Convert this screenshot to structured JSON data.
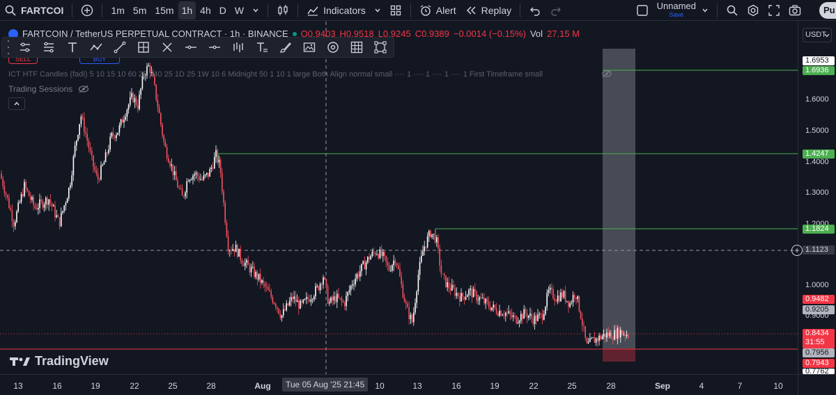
{
  "topbar": {
    "symbol": "FARTCOI",
    "timeframes": [
      "1m",
      "5m",
      "15m",
      "1h",
      "4h",
      "D",
      "W"
    ],
    "active_timeframe": "1h",
    "indicators_label": "Indicators",
    "alert_label": "Alert",
    "replay_label": "Replay",
    "layout_name": "Unnamed",
    "save_label": "Save",
    "publish_label": "Pu"
  },
  "legend": {
    "title": "FARTCOIN / TetherUS PERPETUAL CONTRACT · 1h · BINANCE",
    "open": "O0.9403",
    "high": "H0.9518",
    "low": "L0.9245",
    "close": "C0.9389",
    "change": "−0.0014 (−0.15%)",
    "volume_label": "Vol",
    "volume": "27.15 M"
  },
  "indicators": {
    "ict_line": "ICT HTF Candles (fadi) 5 10 15 10 60 25 240 25 1D 25 1W 10 6 Midnight 50 1 10 1 large Both Align normal small ···· 1 ···· 1 ···· 1 ···· 1 First Timeframe small",
    "sessions_label": "Trading Sessions",
    "sell_label": "SELL",
    "buy_label": "BUY"
  },
  "axis": {
    "currency": "USDT",
    "price_ticks": [
      "1.6000",
      "1.5000",
      "1.4000",
      "1.3000",
      "1.2000",
      "1.0000",
      "0.9000"
    ],
    "time_ticks": [
      "13",
      "16",
      "19",
      "22",
      "25",
      "28",
      "Aug",
      "10",
      "13",
      "16",
      "19",
      "22",
      "25",
      "28",
      "Sep",
      "4",
      "7",
      "10"
    ],
    "crosshair_time": "Tue 05 Aug '25   21:45"
  },
  "price_labels": {
    "level_top": "1.6953",
    "level_1": "1.6936",
    "level_2": "1.4247",
    "level_3": "1.1824",
    "crosshair": "1.1123",
    "red_1": "0.9482",
    "gray_1": "0.9205",
    "last_price": "0.8434",
    "countdown": "31:55",
    "gray_2": "0.7956",
    "red_2": "0.7943",
    "bottom": "0.7762"
  },
  "branding": {
    "logo_text": "TradingView"
  },
  "colors": {
    "background": "#131722",
    "down": "#f7525f",
    "up": "#ffffff",
    "level_green": "#4caf50",
    "level_red": "#f23645",
    "highlight_zone": "#d1d4dc"
  },
  "chart_data": {
    "type": "candlestick",
    "title": "FARTCOIN / TetherUS PERPETUAL CONTRACT · 1h · BINANCE",
    "price_axis_range": [
      0.75,
      1.8
    ],
    "horizontal_levels": [
      1.6936,
      1.4247,
      1.1824,
      0.7943
    ],
    "path_points": [
      [
        0,
        1.36
      ],
      [
        8,
        1.3
      ],
      [
        20,
        1.2
      ],
      [
        35,
        1.32
      ],
      [
        50,
        1.25
      ],
      [
        70,
        1.28
      ],
      [
        85,
        1.2
      ],
      [
        100,
        1.32
      ],
      [
        108,
        1.45
      ],
      [
        116,
        1.55
      ],
      [
        124,
        1.48
      ],
      [
        132,
        1.4
      ],
      [
        140,
        1.34
      ],
      [
        150,
        1.4
      ],
      [
        160,
        1.48
      ],
      [
        170,
        1.5
      ],
      [
        180,
        1.56
      ],
      [
        190,
        1.61
      ],
      [
        198,
        1.58
      ],
      [
        206,
        1.68
      ],
      [
        214,
        1.71
      ],
      [
        220,
        1.66
      ],
      [
        228,
        1.56
      ],
      [
        236,
        1.45
      ],
      [
        244,
        1.4
      ],
      [
        252,
        1.34
      ],
      [
        262,
        1.28
      ],
      [
        270,
        1.35
      ],
      [
        280,
        1.36
      ],
      [
        290,
        1.34
      ],
      [
        300,
        1.36
      ],
      [
        310,
        1.42
      ],
      [
        316,
        1.38
      ],
      [
        322,
        1.24
      ],
      [
        328,
        1.12
      ],
      [
        338,
        1.12
      ],
      [
        348,
        1.08
      ],
      [
        360,
        1.05
      ],
      [
        372,
        1.02
      ],
      [
        384,
        0.98
      ],
      [
        396,
        0.94
      ],
      [
        404,
        0.9
      ],
      [
        412,
        0.93
      ],
      [
        420,
        0.96
      ],
      [
        432,
        0.93
      ],
      [
        444,
        0.96
      ],
      [
        456,
        0.99
      ],
      [
        464,
        1.03
      ],
      [
        472,
        0.94
      ],
      [
        482,
        0.96
      ],
      [
        494,
        0.94
      ],
      [
        506,
        1.01
      ],
      [
        518,
        1.05
      ],
      [
        530,
        1.09
      ],
      [
        540,
        1.11
      ],
      [
        550,
        1.09
      ],
      [
        558,
        1.05
      ],
      [
        568,
        1.09
      ],
      [
        576,
        1.0
      ],
      [
        584,
        0.92
      ],
      [
        592,
        0.88
      ],
      [
        600,
        1.03
      ],
      [
        608,
        1.12
      ],
      [
        618,
        1.17
      ],
      [
        626,
        1.15
      ],
      [
        634,
        1.03
      ],
      [
        642,
        1.0
      ],
      [
        652,
        0.98
      ],
      [
        662,
        0.96
      ],
      [
        674,
        0.98
      ],
      [
        686,
        0.96
      ],
      [
        698,
        0.94
      ],
      [
        712,
        0.92
      ],
      [
        726,
        0.91
      ],
      [
        740,
        0.89
      ],
      [
        754,
        0.91
      ],
      [
        766,
        0.89
      ],
      [
        778,
        0.9
      ],
      [
        788,
        0.98
      ],
      [
        798,
        0.96
      ],
      [
        808,
        0.97
      ],
      [
        818,
        0.94
      ],
      [
        826,
        0.98
      ],
      [
        834,
        0.9
      ],
      [
        842,
        0.8
      ],
      [
        850,
        0.82
      ],
      [
        860,
        0.83
      ],
      [
        870,
        0.84
      ],
      [
        880,
        0.84
      ],
      [
        890,
        0.85
      ],
      [
        902,
        0.84
      ]
    ]
  }
}
